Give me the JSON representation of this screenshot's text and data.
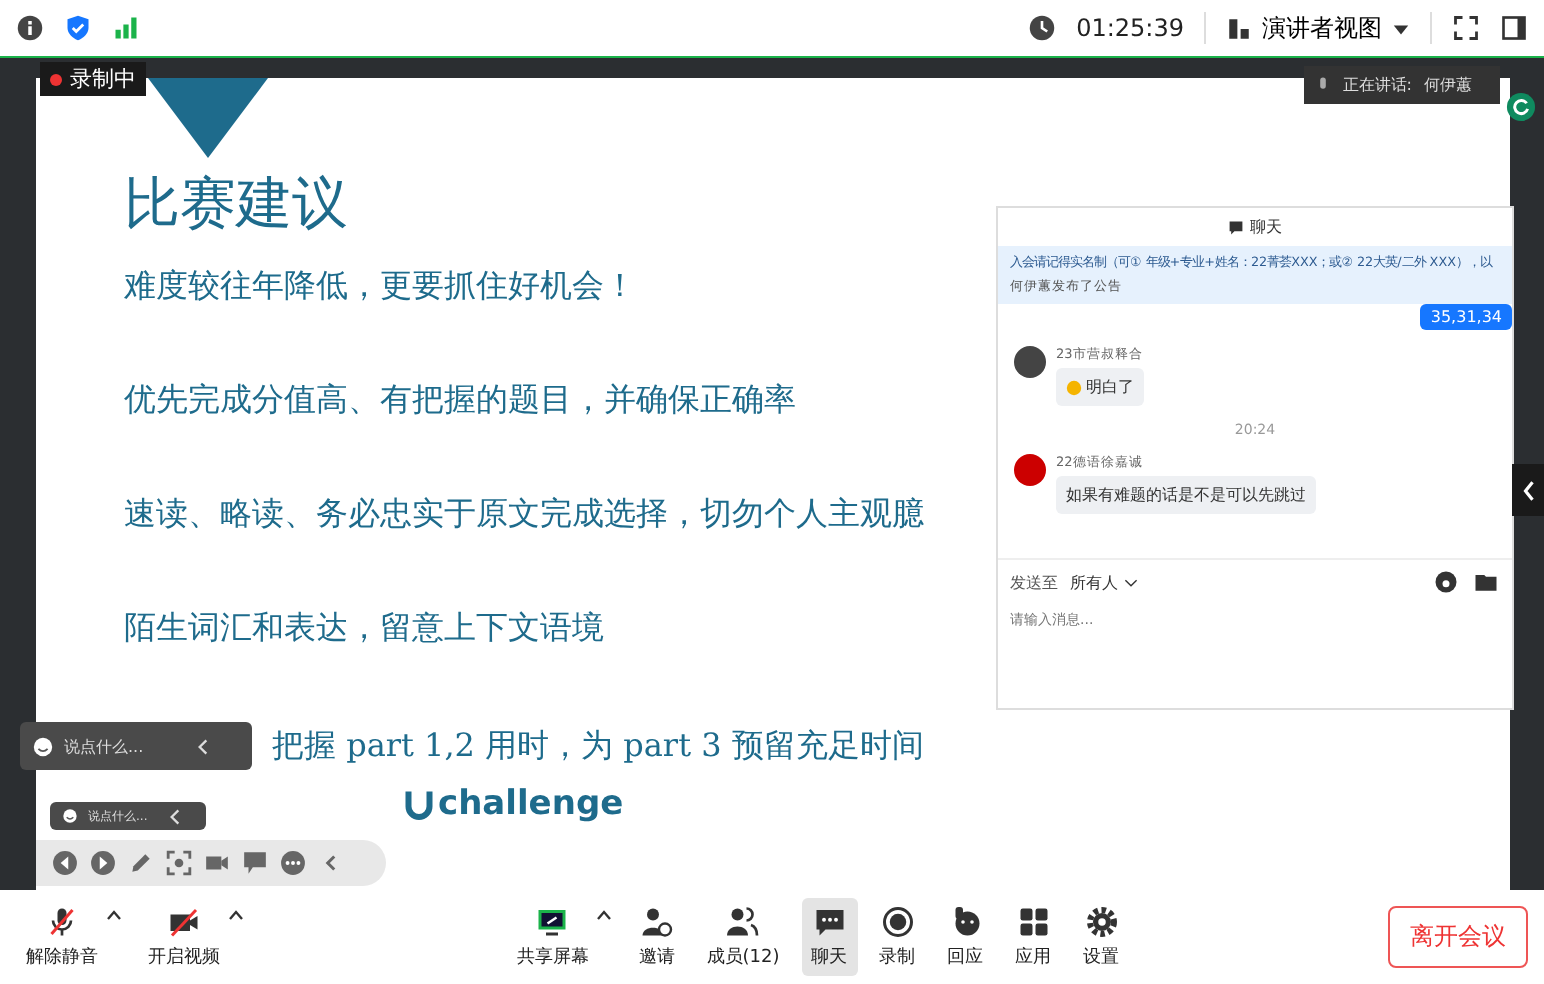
{
  "top_bar": {
    "timer": "01:25:39",
    "view_menu": "演讲者视图"
  },
  "recording": {
    "label": "录制中"
  },
  "speaker": {
    "prefix": "正在讲话:",
    "name": "何伊蕙"
  },
  "slide": {
    "title": "比赛建议",
    "lines": [
      "难度较往年降低，更要抓住好机会！",
      "优先完成分值高、有把握的题目，并确保正确率",
      "速读、略读、务必忠实于原文完成选择，切勿个人主观臆",
      "陌生词汇和表达，留意上下文语境",
      "把握 part 1,2 用时，为 part 3 预留充足时间"
    ],
    "logo": "challenge"
  },
  "chat": {
    "title": "聊天",
    "notice": "入会请记得实名制（可① 年级+专业+姓名：22菁荟XXX；或② 22大英/二外 XXX），以",
    "notice_by": "何伊蕙发布了公告",
    "messages": [
      {
        "kind": "mine",
        "text": "35,31,34"
      },
      {
        "kind": "other",
        "sender": "23市营叔释合",
        "text": "明白了",
        "emoji": true
      },
      {
        "kind": "time",
        "text": "20:24"
      },
      {
        "kind": "other",
        "sender": "22德语徐嘉诚",
        "text": "如果有难题的话是不是可以先跳过",
        "emoji": false
      }
    ],
    "send_to_label": "发送至",
    "recipient": "所有人",
    "placeholder": "请输入消息..."
  },
  "comment_bars": [
    {
      "placeholder": "说点什么..."
    },
    {
      "placeholder": "说点什么..."
    }
  ],
  "toolbar": [
    {
      "kind": "mic",
      "label": "解除静音",
      "selected": false,
      "caret": true
    },
    {
      "kind": "video",
      "label": "开启视频",
      "selected": false,
      "caret": true
    },
    {
      "kind": "share",
      "label": "共享屏幕",
      "selected": false,
      "caret": true
    },
    {
      "kind": "invite",
      "label": "邀请",
      "selected": false,
      "caret": false
    },
    {
      "kind": "members",
      "label": "成员(12)",
      "selected": false,
      "caret": false
    },
    {
      "kind": "chat",
      "label": "聊天",
      "selected": true,
      "caret": false
    },
    {
      "kind": "record",
      "label": "录制",
      "selected": false,
      "caret": false
    },
    {
      "kind": "react",
      "label": "回应",
      "selected": false,
      "caret": false
    },
    {
      "kind": "apps",
      "label": "应用",
      "selected": false,
      "caret": false
    },
    {
      "kind": "settings",
      "label": "设置",
      "selected": false,
      "caret": false
    }
  ],
  "leave_button": "离开会议"
}
